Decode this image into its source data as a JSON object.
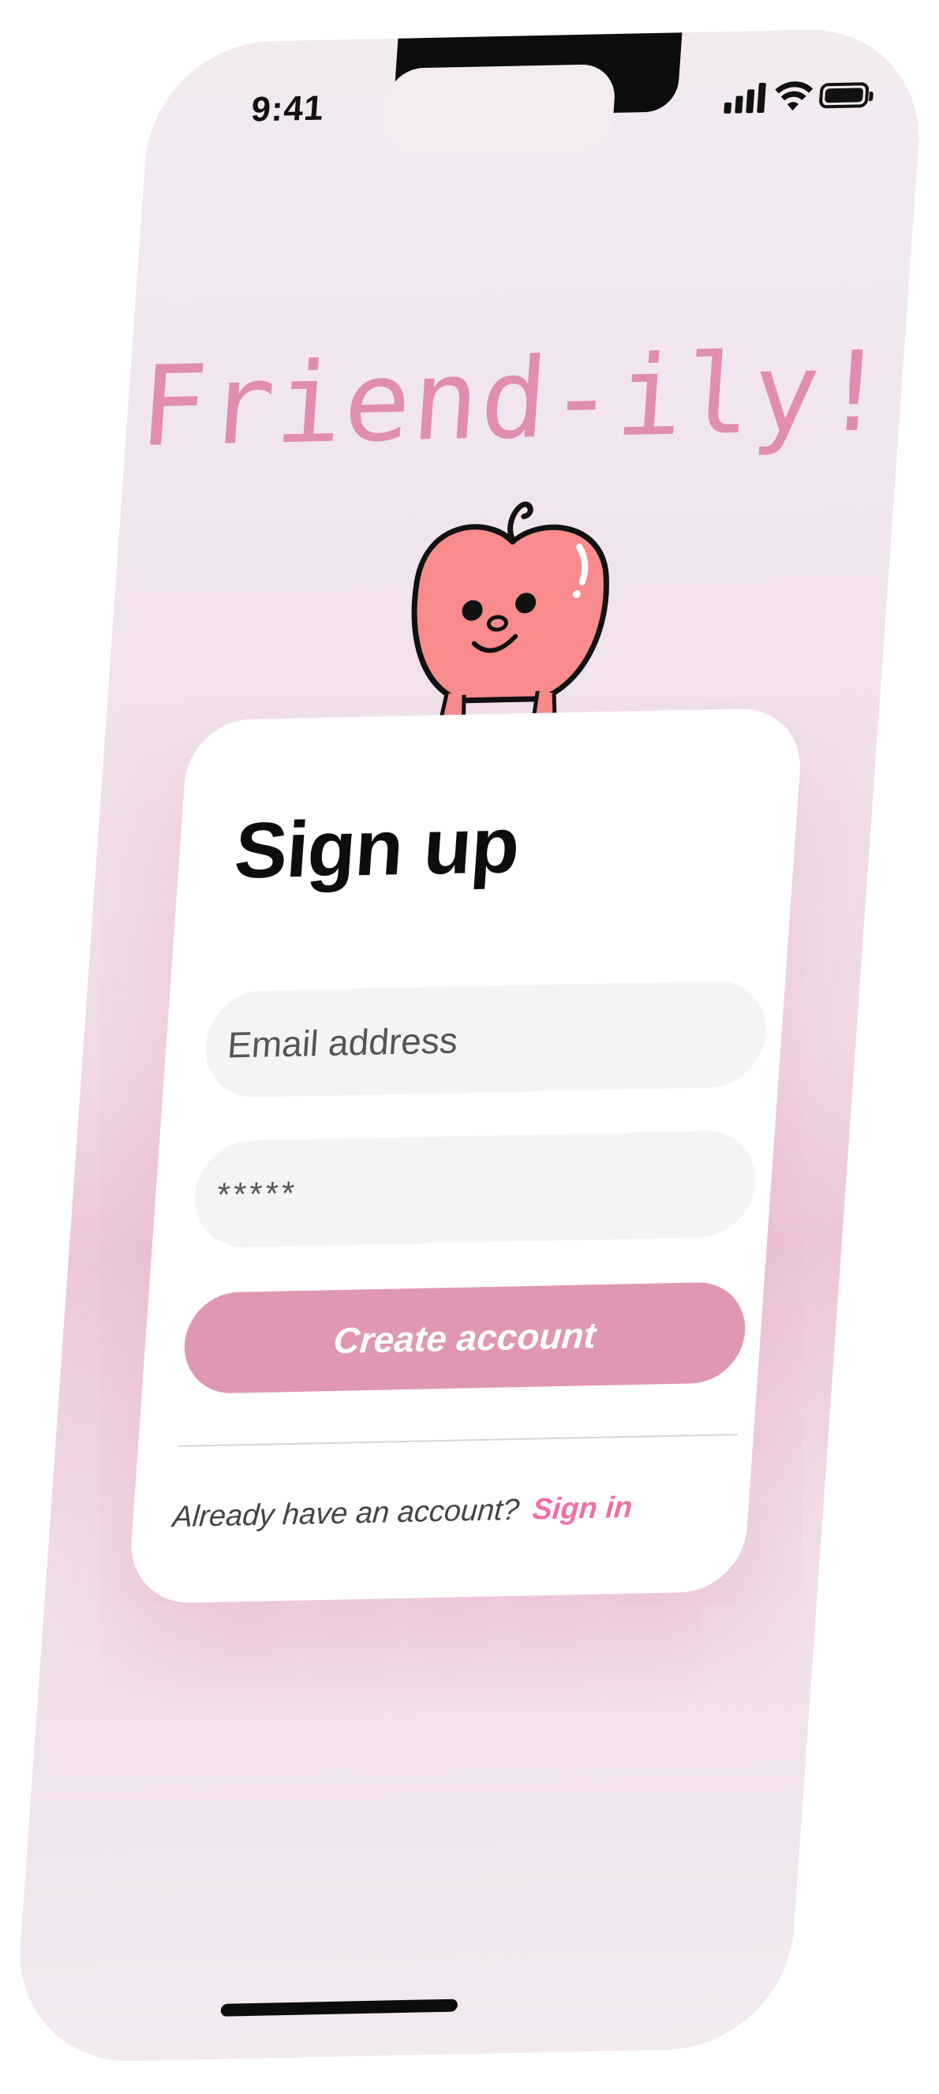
{
  "status_bar": {
    "time": "9:41",
    "icons": [
      "signal-icon",
      "wifi-icon",
      "battery-icon"
    ]
  },
  "app": {
    "title": "Friend-ily!",
    "mascot": "apple-mascot-icon"
  },
  "signup_card": {
    "heading": "Sign up",
    "email_placeholder": "Email address",
    "password_value": "*****",
    "create_button_label": "Create account",
    "footer_prompt": "Already have an account?",
    "signin_label": "Sign in"
  },
  "colors": {
    "accent": "#df97b3",
    "title_pink": "#e08db0",
    "link_pink": "#ef6fa6",
    "background": "#f3eaf0"
  }
}
